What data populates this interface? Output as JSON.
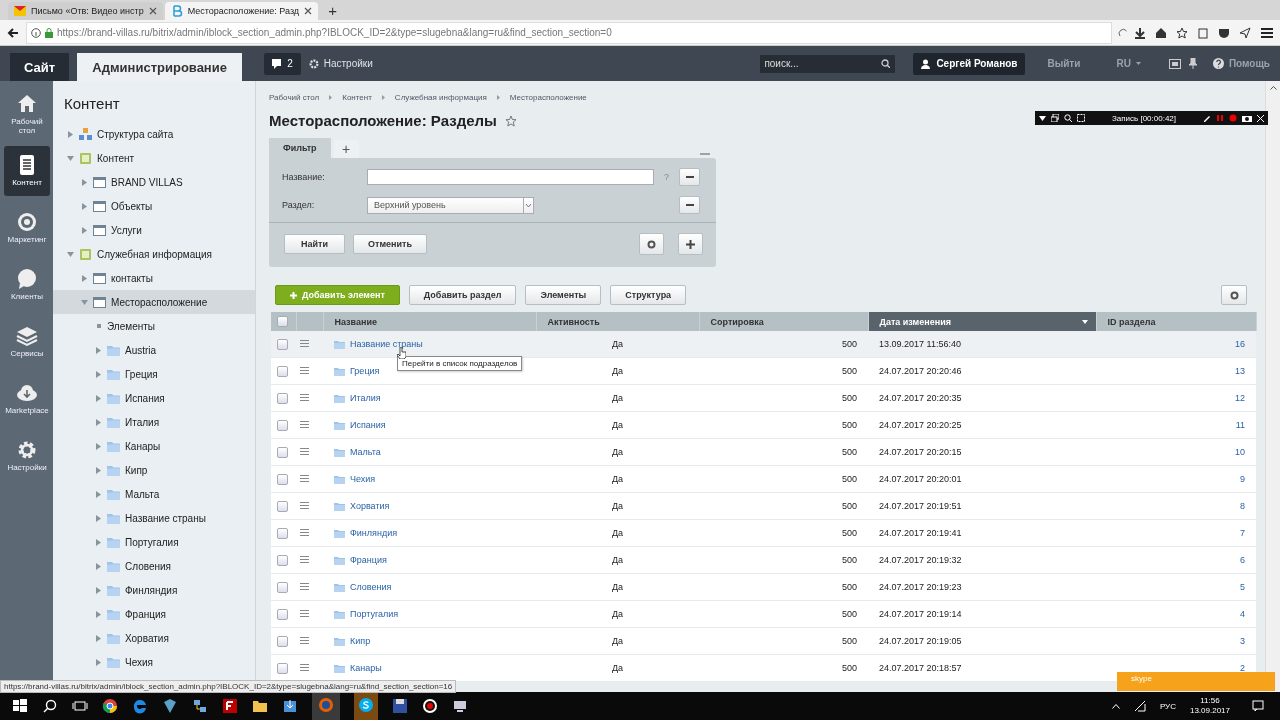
{
  "browser": {
    "tabs": [
      {
        "title": "Письмо «Отв: Видео инстр",
        "selected": false
      },
      {
        "title": "Месторасположение: Разд",
        "selected": true
      }
    ],
    "new_tab": "+",
    "url": "https://brand-villas.ru/bitrix/admin/iblock_section_admin.php?IBLOCK_ID=2&type=slugebna&lang=ru&find_section_section=0"
  },
  "admin_bar": {
    "tabs": [
      {
        "label": "Сайт",
        "selected": false
      },
      {
        "label": "Администрирование",
        "selected": true
      }
    ],
    "notifications": "2",
    "settings": "Настройки",
    "search": {
      "placeholder": "поиск..."
    },
    "user": "Сергей Романов",
    "logout": "Выйти",
    "language": "RU",
    "help": "Помощь"
  },
  "recorder": {
    "status": "Запись [00:00:42]"
  },
  "menu": [
    {
      "kind": "desktop",
      "label": "Рабочий стол",
      "selected": false
    },
    {
      "kind": "content",
      "label": "Контент",
      "selected": true
    },
    {
      "kind": "marketing",
      "label": "Маркетинг",
      "selected": false
    },
    {
      "kind": "clients",
      "label": "Клиенты",
      "selected": false
    },
    {
      "kind": "services",
      "label": "Сервисы",
      "selected": false
    },
    {
      "kind": "marketplace",
      "label": "Marketplace",
      "selected": false
    },
    {
      "kind": "settings",
      "label": "Настройки",
      "selected": false
    }
  ],
  "tree": {
    "title": "Контент",
    "items": [
      {
        "kind": "site",
        "label": "Структура сайта",
        "expanded": false,
        "selected": false
      },
      {
        "kind": "group",
        "label": "Контент",
        "expanded": true,
        "selected": false,
        "children": [
          {
            "kind": "iblock",
            "label": "BRAND VILLAS",
            "expanded": false,
            "selected": false
          },
          {
            "kind": "iblock",
            "label": "Объекты",
            "expanded": false,
            "selected": false
          },
          {
            "kind": "iblock",
            "label": "Услуги",
            "expanded": false,
            "selected": false
          }
        ]
      },
      {
        "kind": "group",
        "label": "Служебная информация",
        "expanded": true,
        "selected": false,
        "children": [
          {
            "kind": "iblock",
            "label": "контакты",
            "expanded": false,
            "selected": false
          },
          {
            "kind": "iblock",
            "label": "Месторасположение",
            "expanded": true,
            "selected": true,
            "children": [
              {
                "kind": "elements",
                "label": "Элементы",
                "selected": false
              },
              {
                "kind": "folder",
                "label": "Austria",
                "expanded": false,
                "selected": false
              },
              {
                "kind": "folder",
                "label": "Греция",
                "expanded": false,
                "selected": false
              },
              {
                "kind": "folder",
                "label": "Испания",
                "expanded": false,
                "selected": false
              },
              {
                "kind": "folder",
                "label": "Италия",
                "expanded": false,
                "selected": false
              },
              {
                "kind": "folder",
                "label": "Канары",
                "expanded": false,
                "selected": false
              },
              {
                "kind": "folder",
                "label": "Кипр",
                "expanded": false,
                "selected": false
              },
              {
                "kind": "folder",
                "label": "Мальта",
                "expanded": false,
                "selected": false
              },
              {
                "kind": "folder",
                "label": "Название страны",
                "expanded": false,
                "selected": false
              },
              {
                "kind": "folder",
                "label": "Португалия",
                "expanded": false,
                "selected": false
              },
              {
                "kind": "folder",
                "label": "Словения",
                "expanded": false,
                "selected": false
              },
              {
                "kind": "folder",
                "label": "Финляндия",
                "expanded": false,
                "selected": false
              },
              {
                "kind": "folder",
                "label": "Франция",
                "expanded": false,
                "selected": false
              },
              {
                "kind": "folder",
                "label": "Хорватия",
                "expanded": false,
                "selected": false
              },
              {
                "kind": "folder",
                "label": "Чехия",
                "expanded": false,
                "selected": false
              }
            ]
          }
        ]
      }
    ]
  },
  "breadcrumbs": [
    "Рабочий стол",
    "Контент",
    "Служебная информация",
    "Месторасположение"
  ],
  "page_title": "Месторасположение: Разделы",
  "filter": {
    "tabs": [
      {
        "label": "Фильтр",
        "selected": true
      }
    ],
    "add_tab": "+",
    "fields": [
      {
        "kind": "text",
        "label": "Название:",
        "help": "?"
      },
      {
        "kind": "select",
        "label": "Раздел:",
        "value": "Верхний уровень"
      }
    ],
    "buttons": [
      "Найти",
      "Отменить"
    ]
  },
  "toolbar": {
    "buttons": [
      {
        "kind": "primary",
        "label": "Добавить элемент"
      },
      {
        "kind": "default",
        "label": "Добавить раздел"
      },
      {
        "kind": "default",
        "label": "Элементы"
      },
      {
        "kind": "default",
        "label": "Структура"
      }
    ]
  },
  "table": {
    "select_all_checked": false,
    "columns": [
      {
        "label": "Название",
        "sorted": false
      },
      {
        "label": "Активность",
        "sorted": false
      },
      {
        "label": "Сортировка",
        "sorted": false
      },
      {
        "label": "Дата изменения",
        "sorted": true
      },
      {
        "label": "ID раздела",
        "sorted": false
      }
    ],
    "rows": [
      {
        "name": "Название страны",
        "active": "Да",
        "sort": "500",
        "modified": "13.09.2017 11:56:40",
        "id": "16",
        "checked": false,
        "hovered": true
      },
      {
        "name": "Греция",
        "active": "Да",
        "sort": "500",
        "modified": "24.07.2017 20:20:46",
        "id": "13",
        "checked": false,
        "hovered": false
      },
      {
        "name": "Италия",
        "active": "Да",
        "sort": "500",
        "modified": "24.07.2017 20:20:35",
        "id": "12",
        "checked": false,
        "hovered": false
      },
      {
        "name": "Испания",
        "active": "Да",
        "sort": "500",
        "modified": "24.07.2017 20:20:25",
        "id": "11",
        "checked": false,
        "hovered": false
      },
      {
        "name": "Мальта",
        "active": "Да",
        "sort": "500",
        "modified": "24.07.2017 20:20:15",
        "id": "10",
        "checked": false,
        "hovered": false
      },
      {
        "name": "Чехия",
        "active": "Да",
        "sort": "500",
        "modified": "24.07.2017 20:20:01",
        "id": "9",
        "checked": false,
        "hovered": false
      },
      {
        "name": "Хорватия",
        "active": "Да",
        "sort": "500",
        "modified": "24.07.2017 20:19:51",
        "id": "8",
        "checked": false,
        "hovered": false
      },
      {
        "name": "Финляндия",
        "active": "Да",
        "sort": "500",
        "modified": "24.07.2017 20:19:41",
        "id": "7",
        "checked": false,
        "hovered": false
      },
      {
        "name": "Франция",
        "active": "Да",
        "sort": "500",
        "modified": "24.07.2017 20:19:32",
        "id": "6",
        "checked": false,
        "hovered": false
      },
      {
        "name": "Словения",
        "active": "Да",
        "sort": "500",
        "modified": "24.07.2017 20:19:23",
        "id": "5",
        "checked": false,
        "hovered": false
      },
      {
        "name": "Португалия",
        "active": "Да",
        "sort": "500",
        "modified": "24.07.2017 20:19:14",
        "id": "4",
        "checked": false,
        "hovered": false
      },
      {
        "name": "Кипр",
        "active": "Да",
        "sort": "500",
        "modified": "24.07.2017 20:19:05",
        "id": "3",
        "checked": false,
        "hovered": false
      },
      {
        "name": "Канары",
        "active": "Да",
        "sort": "500",
        "modified": "24.07.2017 20:18:57",
        "id": "2",
        "checked": false,
        "hovered": false
      }
    ]
  },
  "tooltip": "Перейти в список подразделов",
  "status_url": "https://brand-villas.ru/bitrix/admin/iblock_section_admin.php?IBLOCK_ID=2&type=slugebna&lang=ru&find_section_section=16",
  "notification": {
    "label": "skype"
  },
  "taskbar": {
    "language": "РУС",
    "time": "11:56",
    "date": "13.09.2017"
  }
}
